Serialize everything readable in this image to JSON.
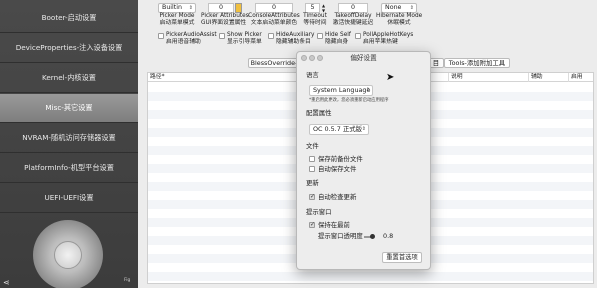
{
  "sidebar": {
    "items": [
      {
        "label": "Booter-启动设置"
      },
      {
        "label": "DeviceProperties-注入设备设置"
      },
      {
        "label": "Kernel-内核设置"
      },
      {
        "label": "Misc-其它设置"
      },
      {
        "label": "NVRAM-随机访问存储器设置"
      },
      {
        "label": "PlatformInfo-机型平台设置"
      },
      {
        "label": "UEFI-UEFI设置"
      }
    ],
    "selected_index": 3,
    "corner_label": "Fig"
  },
  "toolbar": {
    "picker_mode": {
      "value": "Builtin",
      "label_en": "Picker Mode",
      "label_zh": "启动菜单模式"
    },
    "picker_attributes": {
      "value": "0",
      "label_en": "Picker Attributes",
      "label_zh": "GUI界面设置属性"
    },
    "console_attributes": {
      "value": "0",
      "label_en": "ConsoleAttributes",
      "label_zh": "文本启动菜单颜色"
    },
    "timeout": {
      "value": "5",
      "label_en": "Timeout",
      "label_zh": "等待时间"
    },
    "takeoff_delay": {
      "value": "0",
      "label_en": "TakeoffDelay",
      "label_zh": "激活快捷键延迟"
    },
    "hibernate_mode": {
      "value": "None",
      "label_en": "Hibernate Mode",
      "label_zh": "休眠模式"
    },
    "checkboxes": [
      {
        "en": "PickerAudioAssist",
        "zh": "启用语音辅助",
        "checked": false
      },
      {
        "en": "Show Picker",
        "zh": "显示引导菜单",
        "checked": false
      },
      {
        "en": "HideAuxiliary",
        "zh": "隐藏辅助条目",
        "checked": false
      },
      {
        "en": "Hide Self",
        "zh": "隐藏自身",
        "checked": false
      },
      {
        "en": "PollAppleHotKeys",
        "zh": "启用苹果热键",
        "checked": false
      }
    ]
  },
  "tabs": [
    {
      "label": "BlessOverride-"
    },
    {
      "label": "目"
    },
    {
      "label": "Tools-添加附加工具"
    }
  ],
  "table": {
    "columns": [
      "路径*",
      "说明",
      "辅助",
      "启用"
    ]
  },
  "prefs": {
    "title": "偏好设置",
    "language_section": "语言",
    "language_value": "System Language",
    "language_note": "*重启用此更改，您必须重新启动应用程序",
    "config_section": "配置属性",
    "config_value": "OC 0.5.7 正式版",
    "file_section": "文件",
    "backup_label": "保存前备份文件",
    "backup_checked": false,
    "autosave_label": "自动保存文件",
    "autosave_checked": false,
    "update_section": "更新",
    "autoupdate_label": "自动检查更新",
    "autoupdate_checked": true,
    "window_section": "提示窗口",
    "keep_front_label": "保持在最前",
    "keep_front_checked": true,
    "opacity_label": "提示窗口透明度",
    "opacity_value": "0.8",
    "reset_button": "重置首选项"
  }
}
